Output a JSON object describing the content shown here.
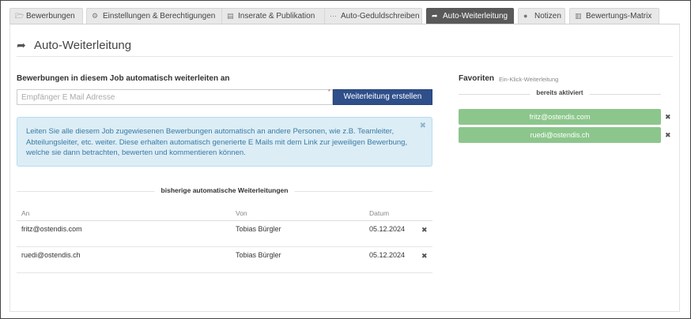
{
  "tabs": [
    {
      "label": "Bewerbungen",
      "icon": "folder-icon",
      "glyph": "🗁",
      "active": false
    },
    {
      "label": "Einstellungen & Berechtigungen",
      "icon": "cogs-icon",
      "glyph": "⚙",
      "active": false
    },
    {
      "label": "Inserate & Publikation",
      "icon": "newspaper-icon",
      "glyph": "▤",
      "active": false
    },
    {
      "label": "Auto-Geduldschreiben",
      "icon": "ellipsis-icon",
      "glyph": "···",
      "active": false
    },
    {
      "label": "Auto-Weiterleitung",
      "icon": "share-icon",
      "glyph": "➦",
      "active": true
    },
    {
      "label": "Notizen",
      "icon": "comment-icon",
      "glyph": "●",
      "active": false
    },
    {
      "label": "Bewertungs-Matrix",
      "icon": "bar-chart-icon",
      "glyph": "▥",
      "active": false
    }
  ],
  "page": {
    "title": "Auto-Weiterleitung",
    "title_icon_glyph": "➦"
  },
  "forward_form": {
    "label": "Bewerbungen in diesem Job automatisch weiterleiten an",
    "placeholder": "Empfänger E Mail Adresse",
    "value": "",
    "required_mark": "*",
    "button_label": "Weiterleitung erstellen"
  },
  "info": {
    "text": "Leiten Sie alle diesem Job zugewiesenen Bewerbungen automatisch an andere Personen, wie z.B. Teamleiter, Abteilungsleiter, etc. weiter. Diese erhalten automatisch generierte E Mails mit dem Link zur jeweiligen Bewerbung, welche sie dann betrachten, bewerten und kommentieren können.",
    "close_glyph": "✖"
  },
  "history": {
    "heading": "bisherige automatische Weiterleitungen",
    "columns": {
      "to": "An",
      "from": "Von",
      "date": "Datum"
    },
    "rows": [
      {
        "to": "fritz@ostendis.com",
        "from": "Tobias Bürgler",
        "date": "05.12.2024"
      },
      {
        "to": "ruedi@ostendis.ch",
        "from": "Tobias Bürgler",
        "date": "05.12.2024"
      }
    ],
    "delete_glyph": "✖"
  },
  "favorites": {
    "heading": "Favoriten",
    "subheading": "Ein-Klick-Weiterleitung",
    "divider_label": "bereits aktiviert",
    "items": [
      {
        "email": "fritz@ostendis.com"
      },
      {
        "email": "ruedi@ostendis.ch"
      }
    ],
    "delete_glyph": "✖",
    "pill_color": "#8cc68c"
  },
  "colors": {
    "active_tab": "#595959",
    "primary_button": "#2f4f8a",
    "info_bg": "#dcedf6",
    "info_text": "#3a7aa3"
  }
}
